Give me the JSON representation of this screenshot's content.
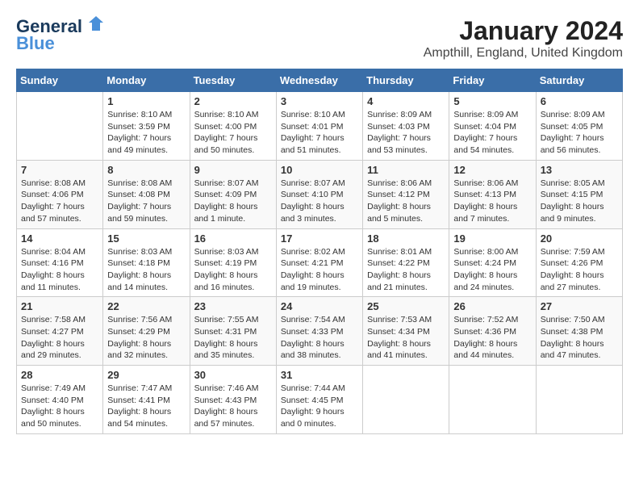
{
  "header": {
    "logo_line1": "General",
    "logo_line2": "Blue",
    "month_title": "January 2024",
    "location": "Ampthill, England, United Kingdom"
  },
  "days_of_week": [
    "Sunday",
    "Monday",
    "Tuesday",
    "Wednesday",
    "Thursday",
    "Friday",
    "Saturday"
  ],
  "weeks": [
    [
      {
        "day": "",
        "sunrise": "",
        "sunset": "",
        "daylight": ""
      },
      {
        "day": "1",
        "sunrise": "Sunrise: 8:10 AM",
        "sunset": "Sunset: 3:59 PM",
        "daylight": "Daylight: 7 hours and 49 minutes."
      },
      {
        "day": "2",
        "sunrise": "Sunrise: 8:10 AM",
        "sunset": "Sunset: 4:00 PM",
        "daylight": "Daylight: 7 hours and 50 minutes."
      },
      {
        "day": "3",
        "sunrise": "Sunrise: 8:10 AM",
        "sunset": "Sunset: 4:01 PM",
        "daylight": "Daylight: 7 hours and 51 minutes."
      },
      {
        "day": "4",
        "sunrise": "Sunrise: 8:09 AM",
        "sunset": "Sunset: 4:03 PM",
        "daylight": "Daylight: 7 hours and 53 minutes."
      },
      {
        "day": "5",
        "sunrise": "Sunrise: 8:09 AM",
        "sunset": "Sunset: 4:04 PM",
        "daylight": "Daylight: 7 hours and 54 minutes."
      },
      {
        "day": "6",
        "sunrise": "Sunrise: 8:09 AM",
        "sunset": "Sunset: 4:05 PM",
        "daylight": "Daylight: 7 hours and 56 minutes."
      }
    ],
    [
      {
        "day": "7",
        "sunrise": "Sunrise: 8:08 AM",
        "sunset": "Sunset: 4:06 PM",
        "daylight": "Daylight: 7 hours and 57 minutes."
      },
      {
        "day": "8",
        "sunrise": "Sunrise: 8:08 AM",
        "sunset": "Sunset: 4:08 PM",
        "daylight": "Daylight: 7 hours and 59 minutes."
      },
      {
        "day": "9",
        "sunrise": "Sunrise: 8:07 AM",
        "sunset": "Sunset: 4:09 PM",
        "daylight": "Daylight: 8 hours and 1 minute."
      },
      {
        "day": "10",
        "sunrise": "Sunrise: 8:07 AM",
        "sunset": "Sunset: 4:10 PM",
        "daylight": "Daylight: 8 hours and 3 minutes."
      },
      {
        "day": "11",
        "sunrise": "Sunrise: 8:06 AM",
        "sunset": "Sunset: 4:12 PM",
        "daylight": "Daylight: 8 hours and 5 minutes."
      },
      {
        "day": "12",
        "sunrise": "Sunrise: 8:06 AM",
        "sunset": "Sunset: 4:13 PM",
        "daylight": "Daylight: 8 hours and 7 minutes."
      },
      {
        "day": "13",
        "sunrise": "Sunrise: 8:05 AM",
        "sunset": "Sunset: 4:15 PM",
        "daylight": "Daylight: 8 hours and 9 minutes."
      }
    ],
    [
      {
        "day": "14",
        "sunrise": "Sunrise: 8:04 AM",
        "sunset": "Sunset: 4:16 PM",
        "daylight": "Daylight: 8 hours and 11 minutes."
      },
      {
        "day": "15",
        "sunrise": "Sunrise: 8:03 AM",
        "sunset": "Sunset: 4:18 PM",
        "daylight": "Daylight: 8 hours and 14 minutes."
      },
      {
        "day": "16",
        "sunrise": "Sunrise: 8:03 AM",
        "sunset": "Sunset: 4:19 PM",
        "daylight": "Daylight: 8 hours and 16 minutes."
      },
      {
        "day": "17",
        "sunrise": "Sunrise: 8:02 AM",
        "sunset": "Sunset: 4:21 PM",
        "daylight": "Daylight: 8 hours and 19 minutes."
      },
      {
        "day": "18",
        "sunrise": "Sunrise: 8:01 AM",
        "sunset": "Sunset: 4:22 PM",
        "daylight": "Daylight: 8 hours and 21 minutes."
      },
      {
        "day": "19",
        "sunrise": "Sunrise: 8:00 AM",
        "sunset": "Sunset: 4:24 PM",
        "daylight": "Daylight: 8 hours and 24 minutes."
      },
      {
        "day": "20",
        "sunrise": "Sunrise: 7:59 AM",
        "sunset": "Sunset: 4:26 PM",
        "daylight": "Daylight: 8 hours and 27 minutes."
      }
    ],
    [
      {
        "day": "21",
        "sunrise": "Sunrise: 7:58 AM",
        "sunset": "Sunset: 4:27 PM",
        "daylight": "Daylight: 8 hours and 29 minutes."
      },
      {
        "day": "22",
        "sunrise": "Sunrise: 7:56 AM",
        "sunset": "Sunset: 4:29 PM",
        "daylight": "Daylight: 8 hours and 32 minutes."
      },
      {
        "day": "23",
        "sunrise": "Sunrise: 7:55 AM",
        "sunset": "Sunset: 4:31 PM",
        "daylight": "Daylight: 8 hours and 35 minutes."
      },
      {
        "day": "24",
        "sunrise": "Sunrise: 7:54 AM",
        "sunset": "Sunset: 4:33 PM",
        "daylight": "Daylight: 8 hours and 38 minutes."
      },
      {
        "day": "25",
        "sunrise": "Sunrise: 7:53 AM",
        "sunset": "Sunset: 4:34 PM",
        "daylight": "Daylight: 8 hours and 41 minutes."
      },
      {
        "day": "26",
        "sunrise": "Sunrise: 7:52 AM",
        "sunset": "Sunset: 4:36 PM",
        "daylight": "Daylight: 8 hours and 44 minutes."
      },
      {
        "day": "27",
        "sunrise": "Sunrise: 7:50 AM",
        "sunset": "Sunset: 4:38 PM",
        "daylight": "Daylight: 8 hours and 47 minutes."
      }
    ],
    [
      {
        "day": "28",
        "sunrise": "Sunrise: 7:49 AM",
        "sunset": "Sunset: 4:40 PM",
        "daylight": "Daylight: 8 hours and 50 minutes."
      },
      {
        "day": "29",
        "sunrise": "Sunrise: 7:47 AM",
        "sunset": "Sunset: 4:41 PM",
        "daylight": "Daylight: 8 hours and 54 minutes."
      },
      {
        "day": "30",
        "sunrise": "Sunrise: 7:46 AM",
        "sunset": "Sunset: 4:43 PM",
        "daylight": "Daylight: 8 hours and 57 minutes."
      },
      {
        "day": "31",
        "sunrise": "Sunrise: 7:44 AM",
        "sunset": "Sunset: 4:45 PM",
        "daylight": "Daylight: 9 hours and 0 minutes."
      },
      {
        "day": "",
        "sunrise": "",
        "sunset": "",
        "daylight": ""
      },
      {
        "day": "",
        "sunrise": "",
        "sunset": "",
        "daylight": ""
      },
      {
        "day": "",
        "sunrise": "",
        "sunset": "",
        "daylight": ""
      }
    ]
  ]
}
